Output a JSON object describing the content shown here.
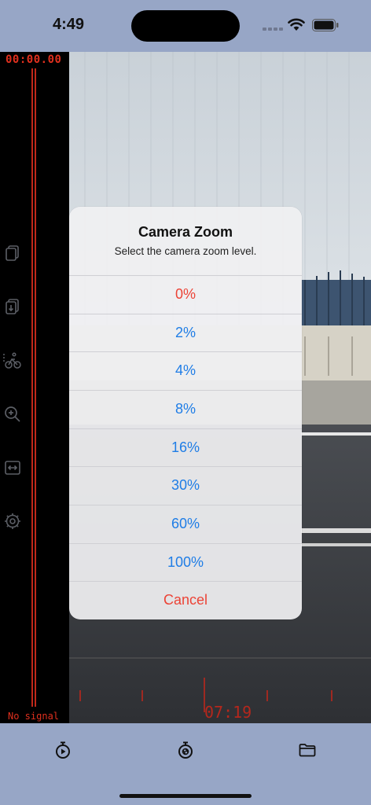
{
  "status_bar": {
    "time": "4:49"
  },
  "left_panel": {
    "timecode": "00:00.00",
    "no_signal": "No signal",
    "icons": [
      "copy-icon",
      "copy-down-icon",
      "rider-icon",
      "zoom-in-icon",
      "expand-horizontal-icon",
      "settings-icon"
    ]
  },
  "video": {
    "timecode": "07:19"
  },
  "alert": {
    "title": "Camera Zoom",
    "message": "Select the camera zoom level.",
    "options": [
      "0%",
      "2%",
      "4%",
      "8%",
      "16%",
      "30%",
      "60%",
      "100%"
    ],
    "selected": "0%",
    "cancel": "Cancel"
  },
  "tab_bar": {
    "icons": [
      "stopwatch-play-icon",
      "stopwatch-aperture-icon",
      "folder-icon"
    ]
  },
  "colors": {
    "accent": "#1f7de6",
    "destructive": "#ec4336",
    "timecode": "#e0301e",
    "chrome": "#97a6c6"
  }
}
